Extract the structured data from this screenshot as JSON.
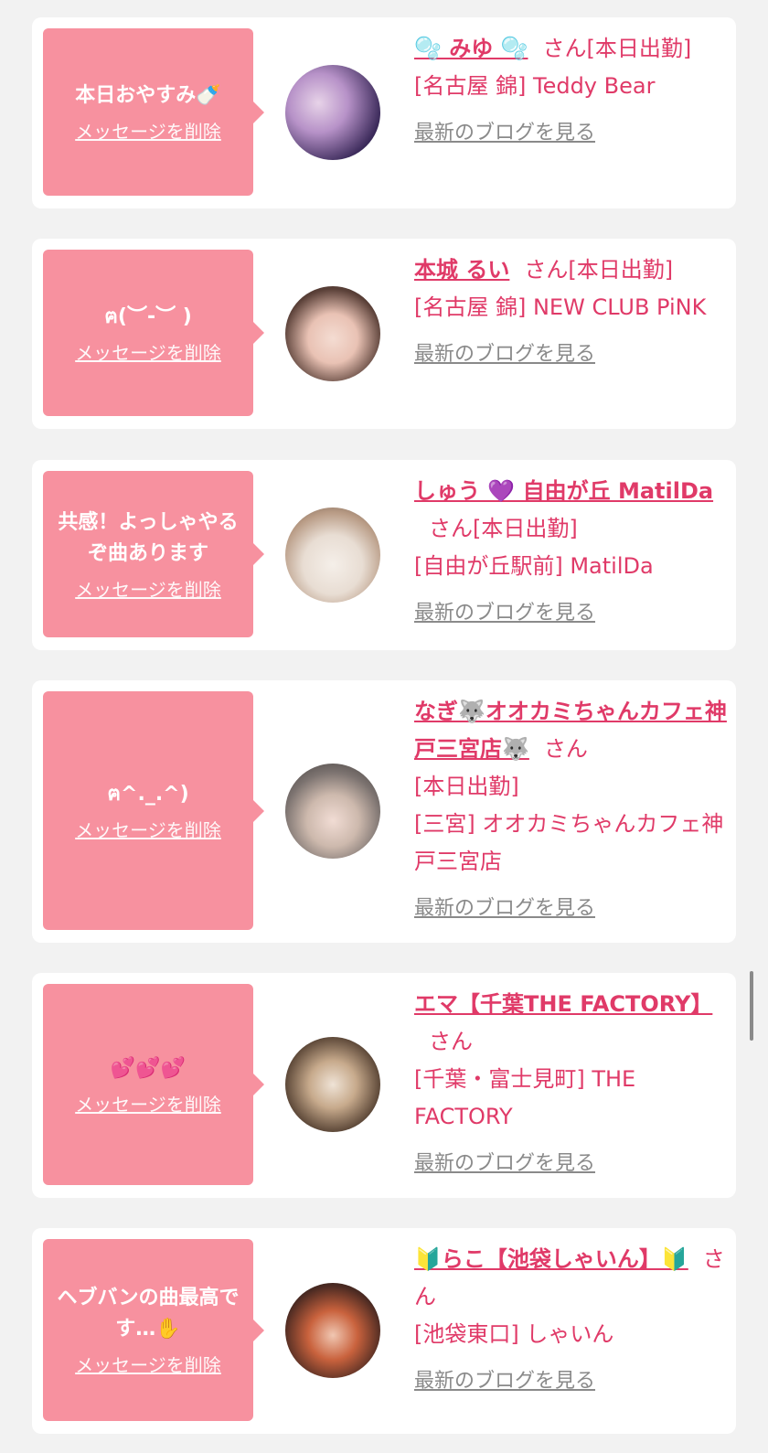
{
  "cards": [
    {
      "message": "本日おやすみ🍼",
      "delete_label": "メッセージを削除",
      "name": "🫧 みゆ 🫧",
      "san": "さん",
      "status": "[本日出勤]",
      "shop": "[名古屋 錦] Teddy Bear",
      "blog_label": "最新のブログを見る"
    },
    {
      "message": "ฅ(︶-︶ )",
      "delete_label": "メッセージを削除",
      "name": "本城 るい",
      "san": "さん",
      "status": "[本日出勤]",
      "shop": "[名古屋 錦] NEW CLUB PiNK",
      "blog_label": "最新のブログを見る"
    },
    {
      "message": "共感！よっしゃやるぞ曲あります",
      "delete_label": "メッセージを削除",
      "name": "しゅう 💜 自由が丘 MatilDa",
      "san": "さん",
      "status": "[本日出勤]",
      "shop": "[自由が丘駅前] MatilDa",
      "blog_label": "最新のブログを見る"
    },
    {
      "message": "ฅ^._.^)",
      "delete_label": "メッセージを削除",
      "name": "なぎ🐺オオカミちゃんカフェ神戸三宮店🐺",
      "san": "さん",
      "status": "[本日出勤]",
      "shop": "[三宮] オオカミちゃんカフェ神戸三宮店",
      "blog_label": "最新のブログを見る"
    },
    {
      "message": "💕💕💕",
      "delete_label": "メッセージを削除",
      "name": "エマ【千葉THE FACTORY】",
      "san": "さん",
      "status": "",
      "shop": "[千葉・富士見町] THE FACTORY",
      "blog_label": "最新のブログを見る"
    },
    {
      "message": "ヘブバンの曲最高です…✋",
      "delete_label": "メッセージを削除",
      "name": "🔰らこ【池袋しゃいん】🔰",
      "san": "さん",
      "status": "",
      "shop": "[池袋東口] しゃいん",
      "blog_label": "最新のブログを見る"
    }
  ],
  "colors": {
    "bubble": "#f7919f",
    "accent": "#e03a68",
    "link_gray": "#8a8a8a"
  }
}
